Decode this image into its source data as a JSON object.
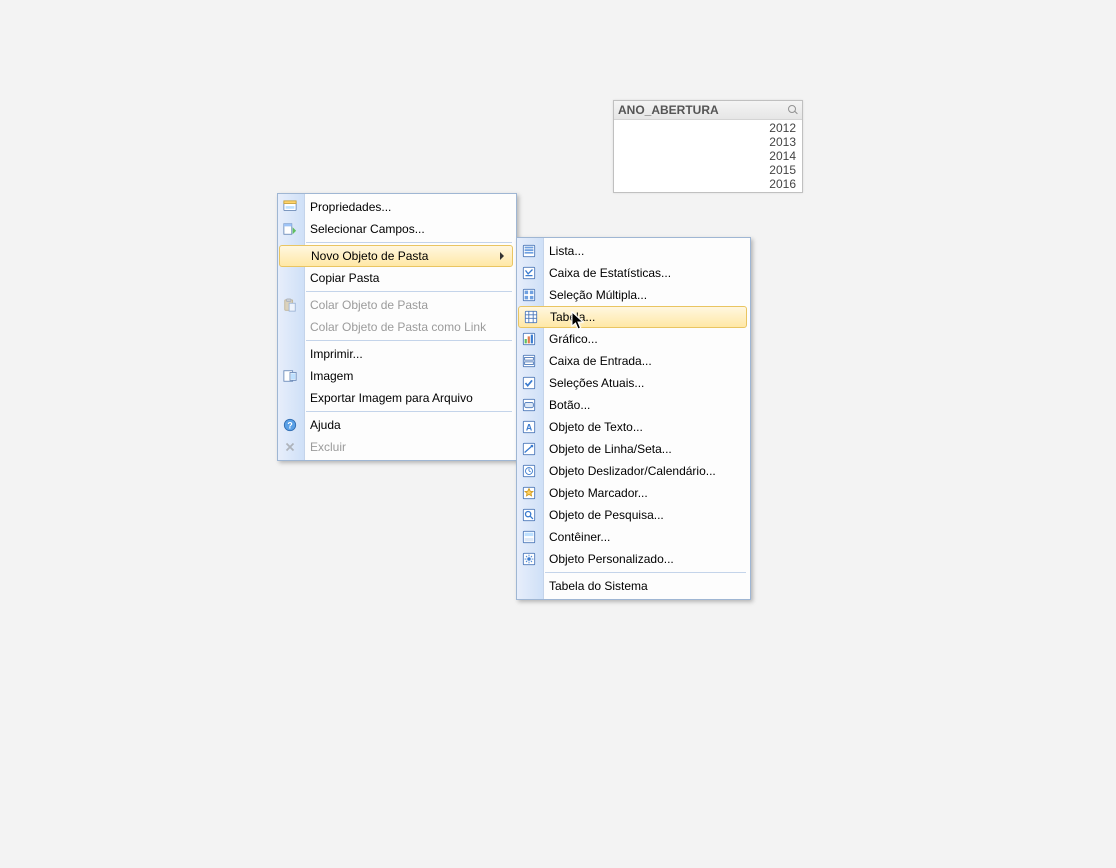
{
  "listbox": {
    "title": "ANO_ABERTURA",
    "values": [
      "2012",
      "2013",
      "2014",
      "2015",
      "2016"
    ]
  },
  "main_menu": {
    "items": [
      {
        "label": "Propriedades...",
        "icon": "properties-icon"
      },
      {
        "label": "Selecionar Campos...",
        "icon": "fields-icon"
      },
      {
        "label": "Novo Objeto de Pasta",
        "icon": "",
        "submenu": true,
        "highlight": true
      },
      {
        "label": "Copiar Pasta",
        "icon": ""
      },
      {
        "label": "Colar Objeto de Pasta",
        "icon": "paste-icon",
        "disabled": true
      },
      {
        "label": "Colar Objeto de Pasta como Link",
        "icon": "",
        "disabled": true
      },
      {
        "label": "Imprimir...",
        "icon": ""
      },
      {
        "label": "Imagem",
        "icon": "image-icon"
      },
      {
        "label": "Exportar Imagem para Arquivo",
        "icon": ""
      },
      {
        "label": "Ajuda",
        "icon": "help-icon"
      },
      {
        "label": "Excluir",
        "icon": "delete-icon",
        "disabled": true
      }
    ]
  },
  "sub_menu": {
    "items": [
      {
        "label": "Lista...",
        "icon": "list-icon"
      },
      {
        "label": "Caixa de Estatísticas...",
        "icon": "stats-icon"
      },
      {
        "label": "Seleção Múltipla...",
        "icon": "multisel-icon"
      },
      {
        "label": "Tabela...",
        "icon": "table-icon",
        "highlight": true
      },
      {
        "label": "Gráfico...",
        "icon": "chart-icon"
      },
      {
        "label": "Caixa de Entrada...",
        "icon": "input-icon"
      },
      {
        "label": "Seleções Atuais...",
        "icon": "selections-icon"
      },
      {
        "label": "Botão...",
        "icon": "button-icon"
      },
      {
        "label": "Objeto de Texto...",
        "icon": "text-icon"
      },
      {
        "label": "Objeto de Linha/Seta...",
        "icon": "line-icon"
      },
      {
        "label": "Objeto Deslizador/Calendário...",
        "icon": "slider-icon"
      },
      {
        "label": "Objeto Marcador...",
        "icon": "bookmark-icon"
      },
      {
        "label": "Objeto de Pesquisa...",
        "icon": "search-icon"
      },
      {
        "label": "Contêiner...",
        "icon": "container-icon"
      },
      {
        "label": "Objeto Personalizado...",
        "icon": "custom-icon"
      },
      {
        "label": "Tabela do Sistema",
        "icon": ""
      }
    ]
  }
}
